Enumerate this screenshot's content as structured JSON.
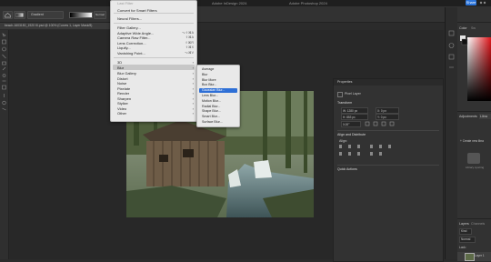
{
  "titlebar": {
    "title_left": "Adobe InDesign 2024",
    "title_right": "Adobe Photoshop 2024",
    "share": "Share"
  },
  "options": {
    "mode_label": "Gradient",
    "blend_label": "Normal"
  },
  "document_tab": "beach-1603150_1920 Kl.psd @ 100% (Curves 1, Layer Mask/8)",
  "filter_menu": {
    "items": [
      {
        "label": "Last Filter",
        "shortcut": "",
        "dim": true
      },
      {
        "label": "Convert for Smart Filters",
        "shortcut": ""
      },
      {
        "label": "Neural Filters...",
        "shortcut": ""
      },
      {
        "label": "Filter Gallery...",
        "shortcut": ""
      },
      {
        "label": "Adaptive Wide Angle...",
        "shortcut": "⌥⇧⌘A"
      },
      {
        "label": "Camera Raw Filter...",
        "shortcut": "⇧⌘A"
      },
      {
        "label": "Lens Correction...",
        "shortcut": "⇧⌘R"
      },
      {
        "label": "Liquify...",
        "shortcut": "⇧⌘X"
      },
      {
        "label": "Vanishing Point...",
        "shortcut": "⌥⌘V"
      },
      {
        "label": "3D",
        "shortcut": ""
      },
      {
        "label": "Blur",
        "shortcut": ""
      },
      {
        "label": "Blur Gallery",
        "shortcut": ""
      },
      {
        "label": "Distort",
        "shortcut": ""
      },
      {
        "label": "Noise",
        "shortcut": ""
      },
      {
        "label": "Pixelate",
        "shortcut": ""
      },
      {
        "label": "Render",
        "shortcut": ""
      },
      {
        "label": "Sharpen",
        "shortcut": ""
      },
      {
        "label": "Stylize",
        "shortcut": ""
      },
      {
        "label": "Video",
        "shortcut": ""
      },
      {
        "label": "Other",
        "shortcut": ""
      }
    ]
  },
  "blur_submenu": {
    "items": [
      "Average",
      "Blur",
      "Blur More",
      "Box Blur...",
      "Gaussian Blur...",
      "Lens Blur...",
      "Motion Blur...",
      "Radial Blur...",
      "Shape Blur...",
      "Smart Blur...",
      "Surface Blur..."
    ],
    "selected_index": 4
  },
  "properties": {
    "tab": "Properties",
    "layer_type": "Pixel Layer",
    "transform": "Transform",
    "w": "W: 1280 px",
    "h": "H: 853 px",
    "x": "X: 0 px",
    "y": "Y: 0 px",
    "angle": "0.00°",
    "align": "Align and Distribute",
    "align_sub": "Align:",
    "quick": "Quick Actions"
  },
  "right_panels": {
    "color_tab": "Color",
    "swatches_tab": "Sw",
    "adjustments_tab": "Adjustments",
    "libraries_tab": "Libra",
    "create_library": "+ Create new libra",
    "library_note": "Library syncing",
    "layers_tab": "Layers",
    "channels_tab": "Channels",
    "kind": "Kind",
    "normal": "Normal",
    "lock": "Lock:",
    "layer_name": "Layer 1"
  },
  "colors": {
    "accent": "#2e6fd6",
    "share": "#2a73d9"
  }
}
